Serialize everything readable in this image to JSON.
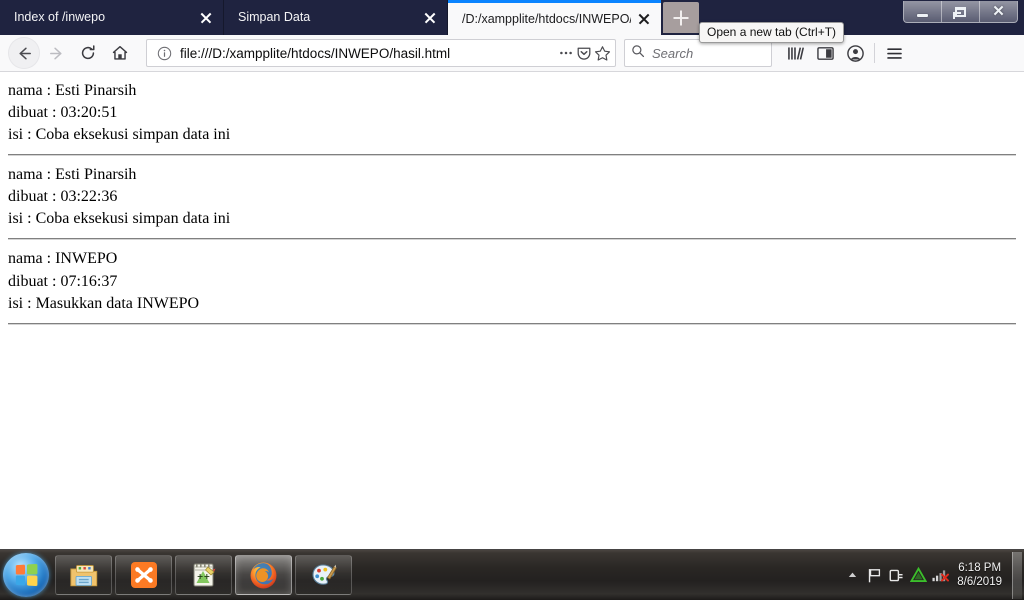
{
  "window": {
    "controls": {
      "minimize_label": "Minimize",
      "restore_label": "Restore Down",
      "close_label": "Close"
    }
  },
  "tabs": [
    {
      "title": "Index of /inwepo",
      "active": false
    },
    {
      "title": "Simpan Data",
      "active": false
    },
    {
      "title": "/D:/xampplite/htdocs/INWEPO/ha",
      "active": true
    }
  ],
  "newtab": {
    "label": "+",
    "tooltip": "Open a new tab (Ctrl+T)"
  },
  "toolbar": {
    "back_label": "Back",
    "forward_label": "Forward",
    "reload_label": "Reload",
    "home_label": "Home",
    "page_actions_label": "Page actions",
    "pocket_label": "Save to Pocket",
    "bookmark_label": "Bookmark this page",
    "library_label": "Library",
    "sidebar_label": "Sidebars",
    "account_label": "Account",
    "menu_label": "Open menu"
  },
  "urlbar": {
    "value": "file:///D:/xampplite/htdocs/INWEPO/hasil.html",
    "identity_icon": "info-icon"
  },
  "search": {
    "placeholder": "Search"
  },
  "page": {
    "entries": [
      {
        "nama": "nama : Esti Pinarsih",
        "dibuat": "dibuat : 03:20:51",
        "isi": "isi : Coba eksekusi simpan data ini"
      },
      {
        "nama": "nama : Esti Pinarsih",
        "dibuat": "dibuat : 03:22:36",
        "isi": "isi : Coba eksekusi simpan data ini"
      },
      {
        "nama": "nama : INWEPO",
        "dibuat": "dibuat : 07:16:37",
        "isi": "isi : Masukkan data INWEPO"
      }
    ]
  },
  "taskbar": {
    "start_label": "Start",
    "buttons": [
      {
        "name": "windows-explorer",
        "label": "Windows Explorer",
        "active": false
      },
      {
        "name": "xampp-control-panel",
        "label": "XAMPP Control Panel",
        "active": false
      },
      {
        "name": "notepad-plus-plus",
        "label": "Notepad++",
        "active": false
      },
      {
        "name": "mozilla-firefox",
        "label": "Mozilla Firefox",
        "active": true
      },
      {
        "name": "paint",
        "label": "Paint",
        "active": false
      }
    ],
    "tray": [
      {
        "name": "show-hidden-icons",
        "label": "Show hidden icons"
      },
      {
        "name": "action-center-flag",
        "label": "Action Center"
      },
      {
        "name": "power-plug",
        "label": "Power"
      },
      {
        "name": "green-triangle",
        "label": "Installed app"
      },
      {
        "name": "network-disconnected",
        "label": "Network - no connection"
      }
    ],
    "clock": {
      "time": "6:18 PM",
      "date": "8/6/2019"
    },
    "show_desktop_label": "Show desktop"
  },
  "colors": {
    "tabbar_bg": "#1f2340",
    "active_tab_accent": "#0a84ff",
    "toolbar_bg": "#f9f9fa",
    "page_bg": "#ffffff"
  }
}
